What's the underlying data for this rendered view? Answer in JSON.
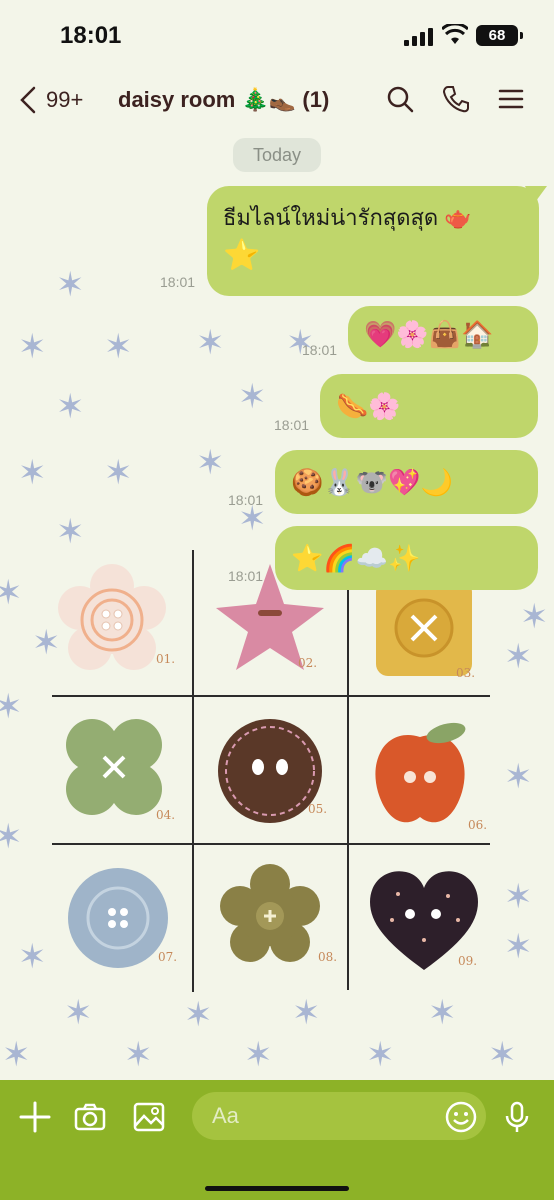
{
  "status": {
    "time": "18:01",
    "battery": "68"
  },
  "header": {
    "unread_count": "99+",
    "title": "daisy room 🎄👞 (1)",
    "icons": [
      "back-icon",
      "search-icon",
      "phone-icon",
      "menu-icon"
    ]
  },
  "chat": {
    "date_label": "Today",
    "messages": [
      {
        "time": "18:01",
        "text": "ธีมไลน์ใหม่น่ารักสุดสุด 🫖",
        "emoji": "⭐"
      },
      {
        "time": "18:01",
        "emoji": "💗🌸👜🏠"
      },
      {
        "time": "18:01",
        "emoji": "🌭🌸"
      },
      {
        "time": "18:01",
        "emoji": "🍪🐰🐨💖🌙"
      },
      {
        "time": "18:01",
        "emoji": "⭐🌈☁️✨"
      }
    ],
    "sticker_numbers": [
      "01.",
      "02.",
      "03.",
      "04.",
      "05.",
      "06.",
      "07.",
      "08.",
      "09."
    ]
  },
  "input": {
    "placeholder": "Aa",
    "icons": [
      "plus-icon",
      "camera-icon",
      "image-icon",
      "emoji-icon",
      "mic-icon"
    ]
  },
  "colors": {
    "background": "#f3f5e9",
    "bubble": "#bfd66b",
    "input_bar": "#8db227",
    "star": "#a9b6d3"
  }
}
